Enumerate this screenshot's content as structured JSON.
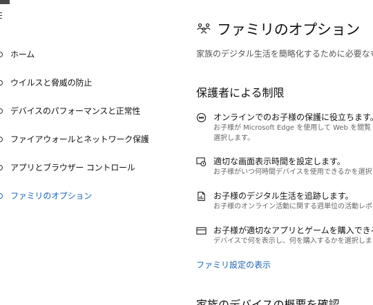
{
  "sidebar": {
    "items": [
      {
        "label": "ホーム",
        "icon": "home-icon"
      },
      {
        "label": "ウイルスと脅威の防止",
        "icon": "shield-icon"
      },
      {
        "label": "デバイスのパフォーマンスと正常性",
        "icon": "heart-icon"
      },
      {
        "label": "ファイアウォールとネットワーク保護",
        "icon": "wifi-icon"
      },
      {
        "label": "アプリとブラウザー コントロール",
        "icon": "app-browser-icon"
      },
      {
        "label": "ファミリのオプション",
        "icon": "family-icon",
        "active": true
      }
    ]
  },
  "main": {
    "title": "ファミリのオプション",
    "subtitle": "家族のデジタル生活を簡略化するために必要なもの",
    "section_title": "保護者による制限",
    "features": [
      {
        "icon": "smiley-icon",
        "title": "オンラインでのお子様の保護に役立ちます。",
        "desc_lines": [
          "お子様が Microsoft Edge を使用して Web を閲覧",
          "選択します。"
        ]
      },
      {
        "icon": "screen-time-icon",
        "title": "適切な画面表示時間を設定します。",
        "desc_lines": [
          "お子様がいつ何時間デバイスを使用できるかを選択し"
        ]
      },
      {
        "icon": "activity-report-icon",
        "title": "お子様のデジタル生活を追跡します。",
        "desc_lines": [
          "お子様のオンライン活動に関する週単位の活動レポー"
        ]
      },
      {
        "icon": "credit-card-icon",
        "title": "お子様が適切なアプリとゲームを購入できるよ",
        "desc_lines": [
          "デバイスで何を表示し、何を購入するかを選択します。"
        ]
      }
    ],
    "link_label": "ファミリ設定の表示",
    "section2_title": "家族のデバイスの概要を確認"
  },
  "colors": {
    "accent": "#1a64b4",
    "text": "#111111",
    "muted": "#666666"
  }
}
